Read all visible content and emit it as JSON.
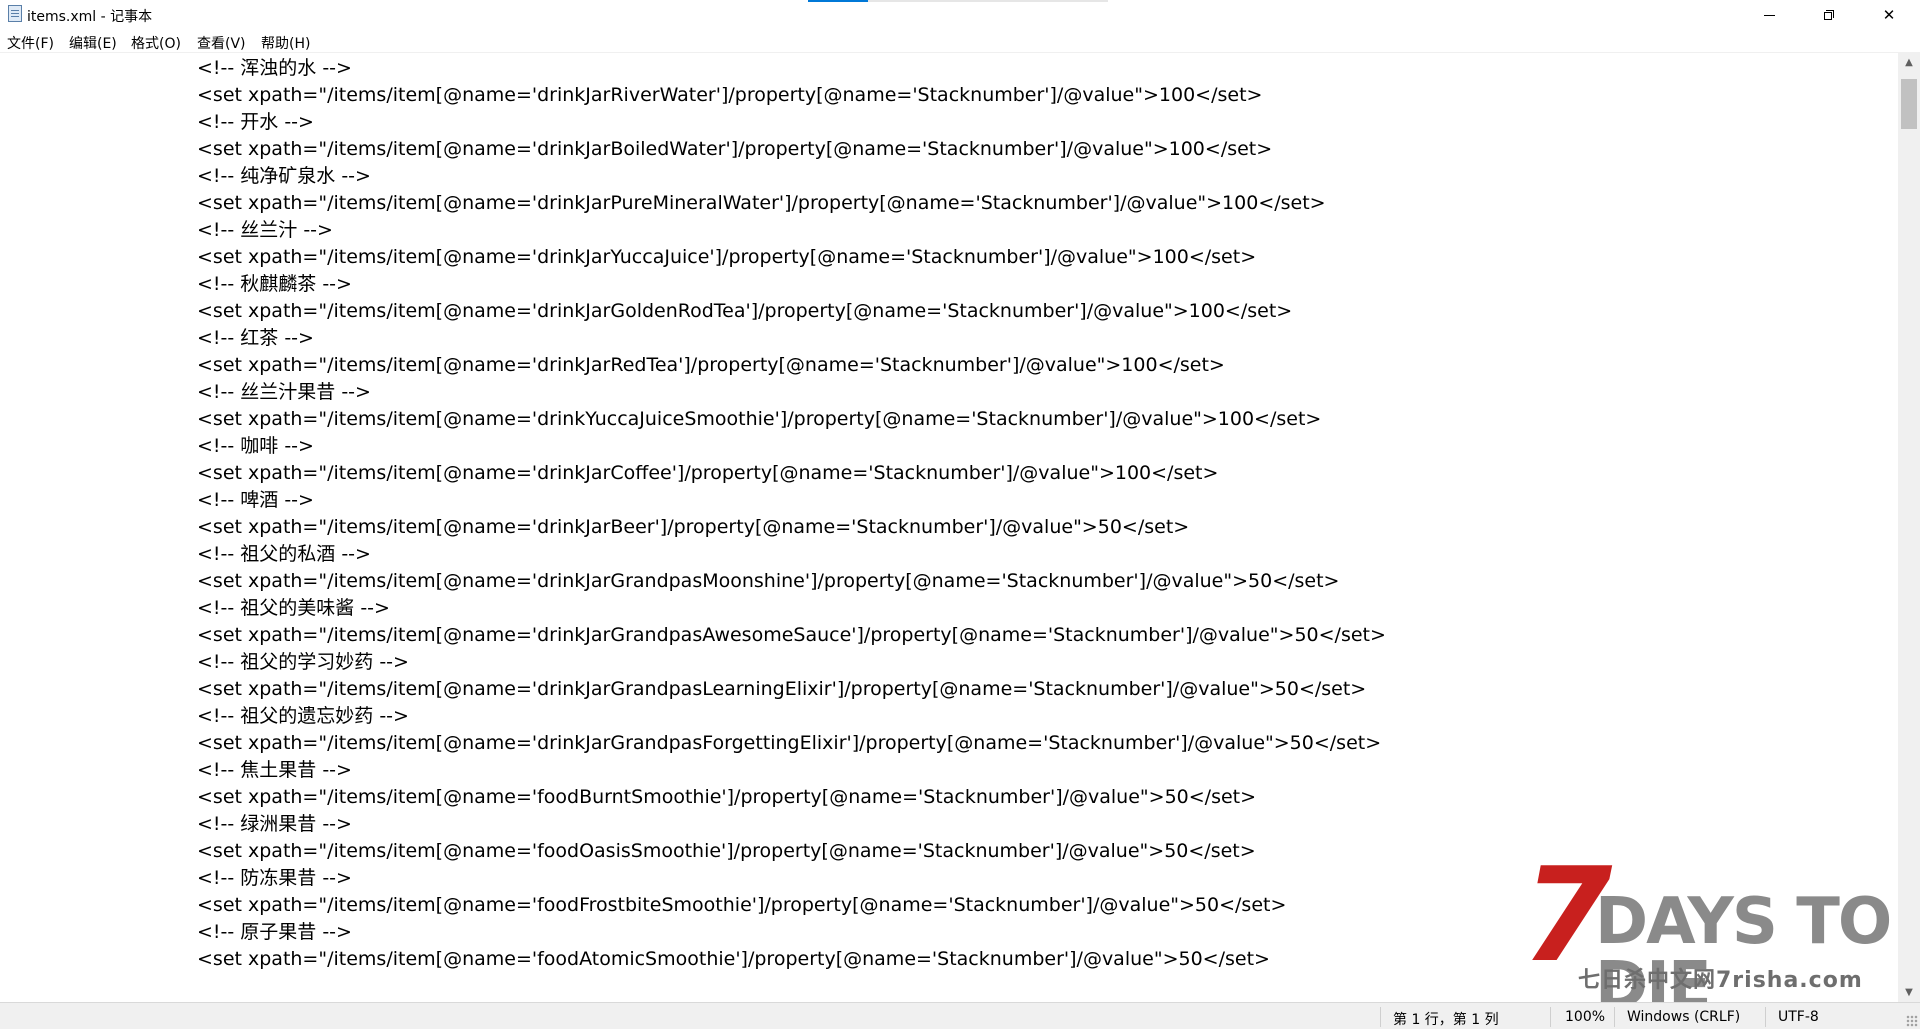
{
  "window": {
    "title": "items.xml - 记事本",
    "icon": "notepad-icon",
    "controls": {
      "minimize": "minimize-icon",
      "maximize": "restore-icon",
      "close": "✕"
    }
  },
  "menu": [
    "文件(F)",
    "编辑(E)",
    "格式(O)",
    "查看(V)",
    "帮助(H)"
  ],
  "lines": [
    "<!-- 浑浊的水 -->",
    "<set xpath=\"/items/item[@name='drinkJarRiverWater']/property[@name='Stacknumber']/@value\">100</set>",
    "<!-- 开水 -->",
    "<set xpath=\"/items/item[@name='drinkJarBoiledWater']/property[@name='Stacknumber']/@value\">100</set>",
    "<!-- 纯净矿泉水 -->",
    "<set xpath=\"/items/item[@name='drinkJarPureMineralWater']/property[@name='Stacknumber']/@value\">100</set>",
    "<!-- 丝兰汁 -->",
    "<set xpath=\"/items/item[@name='drinkJarYuccaJuice']/property[@name='Stacknumber']/@value\">100</set>",
    "<!-- 秋麒麟茶 -->",
    "<set xpath=\"/items/item[@name='drinkJarGoldenRodTea']/property[@name='Stacknumber']/@value\">100</set>",
    "<!-- 红茶 -->",
    "<set xpath=\"/items/item[@name='drinkJarRedTea']/property[@name='Stacknumber']/@value\">100</set>",
    "<!-- 丝兰汁果昔 -->",
    "<set xpath=\"/items/item[@name='drinkYuccaJuiceSmoothie']/property[@name='Stacknumber']/@value\">100</set>",
    "<!-- 咖啡 -->",
    "<set xpath=\"/items/item[@name='drinkJarCoffee']/property[@name='Stacknumber']/@value\">100</set>",
    "<!-- 啤酒 -->",
    "<set xpath=\"/items/item[@name='drinkJarBeer']/property[@name='Stacknumber']/@value\">50</set>",
    "<!-- 祖父的私酒 -->",
    "<set xpath=\"/items/item[@name='drinkJarGrandpasMoonshine']/property[@name='Stacknumber']/@value\">50</set>",
    "<!-- 祖父的美味酱 -->",
    "<set xpath=\"/items/item[@name='drinkJarGrandpasAwesomeSauce']/property[@name='Stacknumber']/@value\">50</set>",
    "<!-- 祖父的学习妙药 -->",
    "<set xpath=\"/items/item[@name='drinkJarGrandpasLearningElixir']/property[@name='Stacknumber']/@value\">50</set>",
    "<!-- 祖父的遗忘妙药 -->",
    "<set xpath=\"/items/item[@name='drinkJarGrandpasForgettingElixir']/property[@name='Stacknumber']/@value\">50</set>",
    "<!-- 焦土果昔 -->",
    "<set xpath=\"/items/item[@name='foodBurntSmoothie']/property[@name='Stacknumber']/@value\">50</set>",
    "<!-- 绿洲果昔 -->",
    "<set xpath=\"/items/item[@name='foodOasisSmoothie']/property[@name='Stacknumber']/@value\">50</set>",
    "<!-- 防冻果昔 -->",
    "<set xpath=\"/items/item[@name='foodFrostbiteSmoothie']/property[@name='Stacknumber']/@value\">50</set>",
    "<!-- 原子果昔 -->",
    "<set xpath=\"/items/item[@name='foodAtomicSmoothie']/property[@name='Stacknumber']/@value\">50</set>"
  ],
  "status": {
    "position": "第 1 行，第 1 列",
    "zoom": "100%",
    "line_ending": "Windows (CRLF)",
    "encoding": "UTF-8"
  },
  "watermark": {
    "logo_number": "7",
    "logo_text": "DAYS TO DIE",
    "site": "七日杀中文网7risha.com"
  }
}
